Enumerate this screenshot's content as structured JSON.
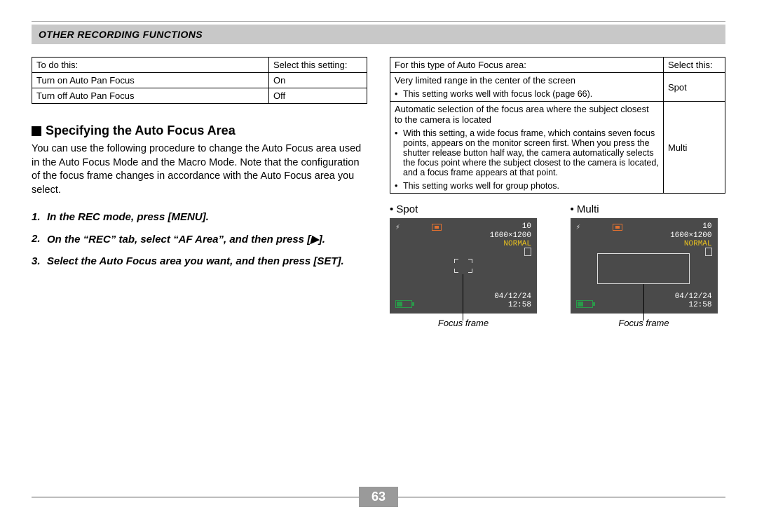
{
  "header": {
    "section_title": "OTHER RECORDING FUNCTIONS"
  },
  "left": {
    "table": {
      "headers": [
        "To do this:",
        "Select this setting:"
      ],
      "rows": [
        [
          "Turn on Auto Pan Focus",
          "On"
        ],
        [
          "Turn off Auto Pan Focus",
          "Off"
        ]
      ]
    },
    "heading": "Specifying the Auto Focus Area",
    "body": "You can use the following procedure to change the Auto Focus area used in the Auto Focus Mode and the Macro Mode. Note that the configuration of the focus frame changes in accordance with the Auto Focus area you select.",
    "steps": [
      "In the REC mode, press [MENU].",
      "On the “REC” tab, select “AF Area”, and then press [▶].",
      "Select the Auto Focus area you want, and then press [SET]."
    ]
  },
  "right": {
    "table": {
      "headers": [
        "For this type of Auto Focus area:",
        "Select this:"
      ],
      "rows": [
        {
          "desc": "Very limited range in the center of the screen",
          "bullets": [
            "This setting works well with focus lock (page 66)."
          ],
          "select": "Spot"
        },
        {
          "desc": "Automatic selection of the focus area where the subject closest to the camera is located",
          "bullets": [
            "With this setting, a wide focus frame, which contains seven focus points, appears on the monitor screen first.  When you press the shutter release button half way, the camera automatically selects the focus point where the subject closest to the camera is located, and a focus frame appears at that point.",
            "This setting works well for group photos."
          ],
          "select": "Multi"
        }
      ]
    },
    "previews": {
      "spot_label": "Spot",
      "multi_label": "Multi",
      "lcd": {
        "remaining": "10",
        "resolution": "1600×1200",
        "quality": "NORMAL",
        "date": "04/12/24",
        "time": "12:58"
      },
      "callout": "Focus frame"
    }
  },
  "page_number": "63"
}
